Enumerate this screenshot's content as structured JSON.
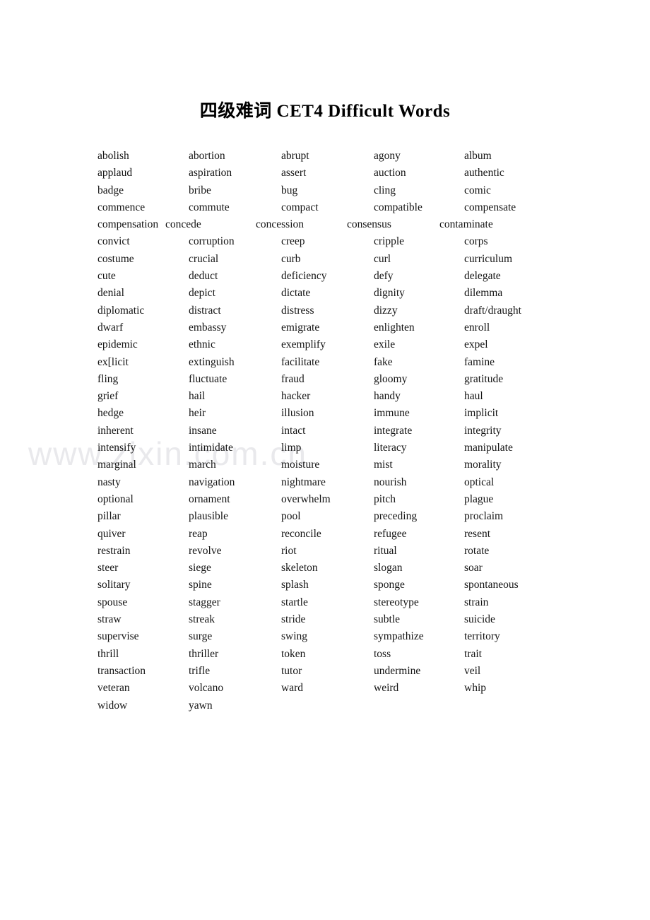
{
  "document": {
    "title": "四级难词 CET4 Difficult Words",
    "watermark": "www.zixin.com.cn",
    "page_background": "#ffffff",
    "text_color": "#141414",
    "watermark_color": "#e9e9ec"
  },
  "word_list": {
    "columns": 5,
    "rows": [
      {
        "irregular": false,
        "words": [
          "abolish",
          "abortion",
          "abrupt",
          "agony",
          "album"
        ]
      },
      {
        "irregular": false,
        "words": [
          "applaud",
          "aspiration",
          "assert",
          "auction",
          "authentic"
        ]
      },
      {
        "irregular": false,
        "words": [
          "badge",
          "bribe",
          "bug",
          "cling",
          "comic"
        ]
      },
      {
        "irregular": false,
        "words": [
          "commence",
          "commute",
          "compact",
          "compatible",
          "compensate"
        ]
      },
      {
        "irregular": true,
        "words": [
          "compensation",
          "concede",
          "concession",
          "consensus",
          "contaminate"
        ]
      },
      {
        "irregular": false,
        "words": [
          "convict",
          "corruption",
          "creep",
          "cripple",
          "corps"
        ]
      },
      {
        "irregular": false,
        "words": [
          "costume",
          "crucial",
          "curb",
          "curl",
          "curriculum"
        ]
      },
      {
        "irregular": false,
        "words": [
          "cute",
          "deduct",
          "deficiency",
          "defy",
          "delegate"
        ]
      },
      {
        "irregular": false,
        "words": [
          "denial",
          "depict",
          "dictate",
          "dignity",
          "dilemma"
        ]
      },
      {
        "irregular": false,
        "words": [
          "diplomatic",
          "distract",
          "distress",
          "dizzy",
          "draft/draught"
        ]
      },
      {
        "irregular": false,
        "words": [
          "dwarf",
          "embassy",
          "emigrate",
          "enlighten",
          "enroll"
        ]
      },
      {
        "irregular": false,
        "words": [
          "epidemic",
          "ethnic",
          "exemplify",
          "exile",
          "expel"
        ]
      },
      {
        "irregular": false,
        "words": [
          "ex[licit",
          "extinguish",
          "facilitate",
          "fake",
          "famine"
        ]
      },
      {
        "irregular": false,
        "words": [
          "fling",
          "fluctuate",
          "fraud",
          "gloomy",
          "gratitude"
        ]
      },
      {
        "irregular": false,
        "words": [
          "grief",
          "hail",
          "hacker",
          "handy",
          "haul"
        ]
      },
      {
        "irregular": false,
        "words": [
          "hedge",
          "heir",
          "illusion",
          "immune",
          "implicit"
        ]
      },
      {
        "irregular": false,
        "words": [
          "inherent",
          "insane",
          "intact",
          "integrate",
          "integrity"
        ]
      },
      {
        "irregular": false,
        "words": [
          "intensify",
          "intimidate",
          "limp",
          "literacy",
          "manipulate"
        ]
      },
      {
        "irregular": false,
        "words": [
          "marginal",
          "march",
          "moisture",
          "mist",
          "morality"
        ]
      },
      {
        "irregular": false,
        "words": [
          "nasty",
          "navigation",
          "nightmare",
          "nourish",
          "optical"
        ]
      },
      {
        "irregular": false,
        "words": [
          "optional",
          "ornament",
          "overwhelm",
          "pitch",
          "plague"
        ]
      },
      {
        "irregular": false,
        "words": [
          "pillar",
          "plausible",
          "pool",
          "preceding",
          "proclaim"
        ]
      },
      {
        "irregular": false,
        "words": [
          "quiver",
          "reap",
          "reconcile",
          "refugee",
          "resent"
        ]
      },
      {
        "irregular": false,
        "words": [
          "restrain",
          "revolve",
          "riot",
          "ritual",
          "rotate"
        ]
      },
      {
        "irregular": false,
        "words": [
          "steer",
          "siege",
          "skeleton",
          "slogan",
          "soar"
        ]
      },
      {
        "irregular": false,
        "words": [
          "solitary",
          "spine",
          "splash",
          "sponge",
          "spontaneous"
        ]
      },
      {
        "irregular": false,
        "words": [
          "spouse",
          "stagger",
          "startle",
          "stereotype",
          "strain"
        ]
      },
      {
        "irregular": false,
        "words": [
          "straw",
          "streak",
          "stride",
          "subtle",
          "suicide"
        ]
      },
      {
        "irregular": false,
        "words": [
          "supervise",
          "surge",
          "swing",
          "sympathize",
          "territory"
        ]
      },
      {
        "irregular": false,
        "words": [
          "thrill",
          "thriller",
          "token",
          "toss",
          "trait"
        ]
      },
      {
        "irregular": false,
        "words": [
          "transaction",
          "trifle",
          "tutor",
          "undermine",
          "veil"
        ]
      },
      {
        "irregular": false,
        "words": [
          "veteran",
          "volcano",
          "ward",
          "weird",
          "whip"
        ]
      },
      {
        "irregular": false,
        "words": [
          "widow",
          "yawn"
        ]
      }
    ]
  }
}
